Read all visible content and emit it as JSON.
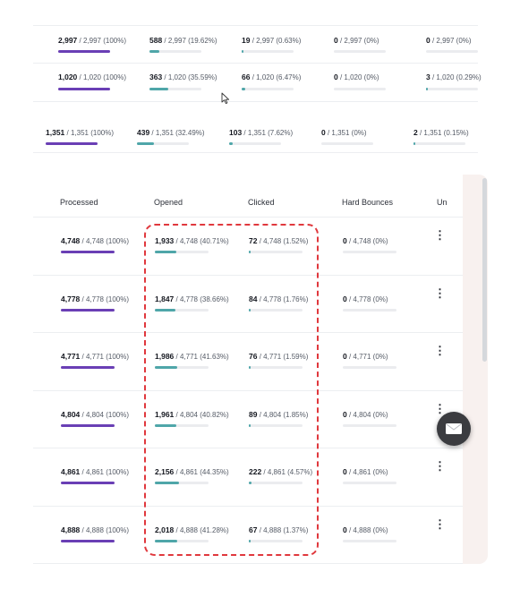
{
  "top_rows": [
    {
      "processed": {
        "count": "2,997",
        "detail": "/ 2,997 (100%)",
        "fraction": 1.0
      },
      "opened": {
        "count": "588",
        "detail": "/ 2,997 (19.62%)",
        "fraction": 0.1962
      },
      "clicked": {
        "count": "19",
        "detail": "/ 2,997 (0.63%)",
        "fraction": 0.0063
      },
      "hard_bounces": {
        "count": "0",
        "detail": "/ 2,997 (0%)",
        "fraction": 0
      },
      "unsubscribes": {
        "count": "0",
        "detail": "/ 2,997 (0%)",
        "fraction": 0
      }
    },
    {
      "processed": {
        "count": "1,020",
        "detail": "/ 1,020 (100%)",
        "fraction": 1.0
      },
      "opened": {
        "count": "363",
        "detail": "/ 1,020 (35.59%)",
        "fraction": 0.3559
      },
      "clicked": {
        "count": "66",
        "detail": "/ 1,020 (6.47%)",
        "fraction": 0.0647
      },
      "hard_bounces": {
        "count": "0",
        "detail": "/ 1,020 (0%)",
        "fraction": 0
      },
      "unsubscribes": {
        "count": "3",
        "detail": "/ 1,020 (0.29%)",
        "fraction": 0.0029
      }
    },
    {
      "processed": {
        "count": "1,351",
        "detail": "/ 1,351 (100%)",
        "fraction": 1.0
      },
      "opened": {
        "count": "439",
        "detail": "/ 1,351 (32.49%)",
        "fraction": 0.3249
      },
      "clicked": {
        "count": "103",
        "detail": "/ 1,351 (7.62%)",
        "fraction": 0.0762
      },
      "hard_bounces": {
        "count": "0",
        "detail": "/ 1,351 (0%)",
        "fraction": 0
      },
      "unsubscribes": {
        "count": "2",
        "detail": "/ 1,351 (0.15%)",
        "fraction": 0.0015
      }
    }
  ],
  "table": {
    "headers": {
      "processed": "Processed",
      "opened": "Opened",
      "clicked": "Clicked",
      "hard_bounces": "Hard Bounces",
      "unsubscribes": "Un"
    },
    "rows": [
      {
        "processed": {
          "count": "4,748",
          "detail": "/ 4,748 (100%)",
          "fraction": 1.0
        },
        "opened": {
          "count": "1,933",
          "detail": "/ 4,748 (40.71%)",
          "fraction": 0.4071
        },
        "clicked": {
          "count": "72",
          "detail": "/ 4,748 (1.52%)",
          "fraction": 0.0152
        },
        "hard_bounces": {
          "count": "0",
          "detail": "/ 4,748 (0%)",
          "fraction": 0
        }
      },
      {
        "processed": {
          "count": "4,778",
          "detail": "/ 4,778 (100%)",
          "fraction": 1.0
        },
        "opened": {
          "count": "1,847",
          "detail": "/ 4,778 (38.66%)",
          "fraction": 0.3866
        },
        "clicked": {
          "count": "84",
          "detail": "/ 4,778 (1.76%)",
          "fraction": 0.0176
        },
        "hard_bounces": {
          "count": "0",
          "detail": "/ 4,778 (0%)",
          "fraction": 0
        }
      },
      {
        "processed": {
          "count": "4,771",
          "detail": "/ 4,771 (100%)",
          "fraction": 1.0
        },
        "opened": {
          "count": "1,986",
          "detail": "/ 4,771 (41.63%)",
          "fraction": 0.4163
        },
        "clicked": {
          "count": "76",
          "detail": "/ 4,771 (1.59%)",
          "fraction": 0.0159
        },
        "hard_bounces": {
          "count": "0",
          "detail": "/ 4,771 (0%)",
          "fraction": 0
        }
      },
      {
        "processed": {
          "count": "4,804",
          "detail": "/ 4,804 (100%)",
          "fraction": 1.0
        },
        "opened": {
          "count": "1,961",
          "detail": "/ 4,804 (40.82%)",
          "fraction": 0.4082
        },
        "clicked": {
          "count": "89",
          "detail": "/ 4,804 (1.85%)",
          "fraction": 0.0185
        },
        "hard_bounces": {
          "count": "0",
          "detail": "/ 4,804 (0%)",
          "fraction": 0
        }
      },
      {
        "processed": {
          "count": "4,861",
          "detail": "/ 4,861 (100%)",
          "fraction": 1.0
        },
        "opened": {
          "count": "2,156",
          "detail": "/ 4,861 (44.35%)",
          "fraction": 0.4435
        },
        "clicked": {
          "count": "222",
          "detail": "/ 4,861 (4.57%)",
          "fraction": 0.0457
        },
        "hard_bounces": {
          "count": "0",
          "detail": "/ 4,861 (0%)",
          "fraction": 0
        }
      },
      {
        "processed": {
          "count": "4,888",
          "detail": "/ 4,888 (100%)",
          "fraction": 1.0
        },
        "opened": {
          "count": "2,018",
          "detail": "/ 4,888 (41.28%)",
          "fraction": 0.4128
        },
        "clicked": {
          "count": "67",
          "detail": "/ 4,888 (1.37%)",
          "fraction": 0.0137
        },
        "hard_bounces": {
          "count": "0",
          "detail": "/ 4,888 (0%)",
          "fraction": 0
        }
      }
    ],
    "row_menu_icon": "kebab-vertical-icon"
  },
  "floating_button_icon": "envelope-icon",
  "cursor_icon": "mouse-pointer-icon",
  "colors": {
    "processed_bar": "#6a3fb5",
    "rate_bar": "#4fa6a9",
    "highlight_border": "#e0383d"
  }
}
